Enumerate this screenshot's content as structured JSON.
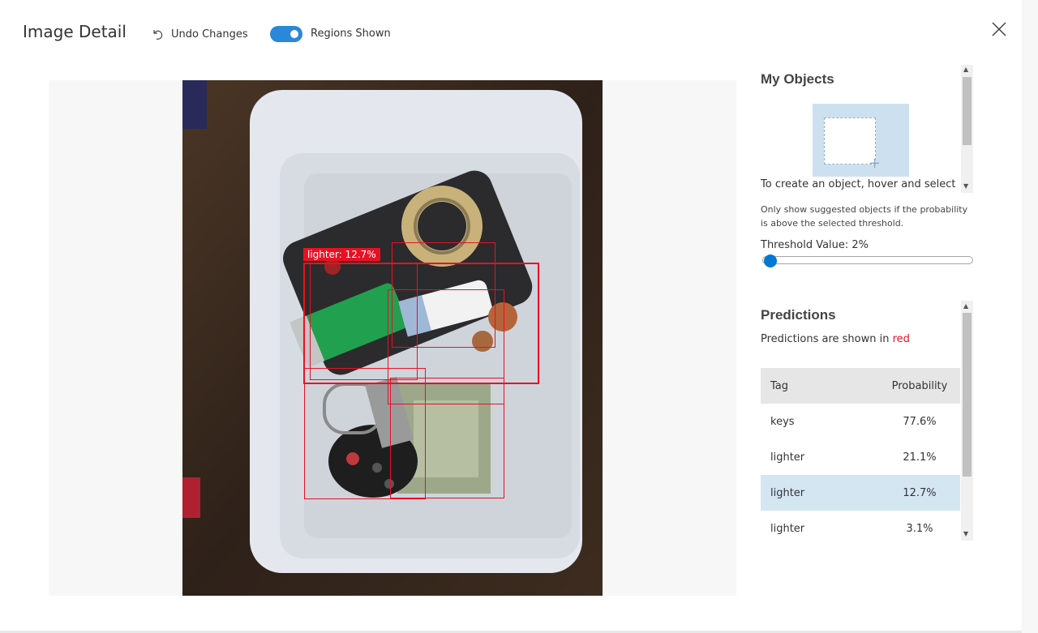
{
  "header": {
    "title": "Image Detail",
    "undo_label": "Undo Changes",
    "regions_toggle_label": "Regions Shown",
    "regions_toggle_on": true
  },
  "my_objects": {
    "title": "My Objects",
    "hint": "To create an object, hover and select"
  },
  "threshold": {
    "help": "Only show suggested objects if the probability is above the selected threshold.",
    "label": "Threshold Value: 2%",
    "value_percent": 2
  },
  "predictions": {
    "title": "Predictions",
    "note_prefix": "Predictions are shown in ",
    "note_color_word": "red",
    "columns": [
      "Tag",
      "Probability"
    ],
    "rows": [
      {
        "tag": "keys",
        "probability": "77.6%"
      },
      {
        "tag": "lighter",
        "probability": "21.1%"
      },
      {
        "tag": "lighter",
        "probability": "12.7%",
        "selected": true
      },
      {
        "tag": "lighter",
        "probability": "3.1%"
      }
    ]
  },
  "image": {
    "selected_region_label": "lighter: 12.7%"
  },
  "colors": {
    "accent": "#0078d4",
    "toggle_on": "#2b88d8",
    "prediction_red": "#e81123",
    "selected_row": "#d5e6f3"
  },
  "icons": {
    "undo": "undo-icon",
    "close": "close-icon"
  }
}
